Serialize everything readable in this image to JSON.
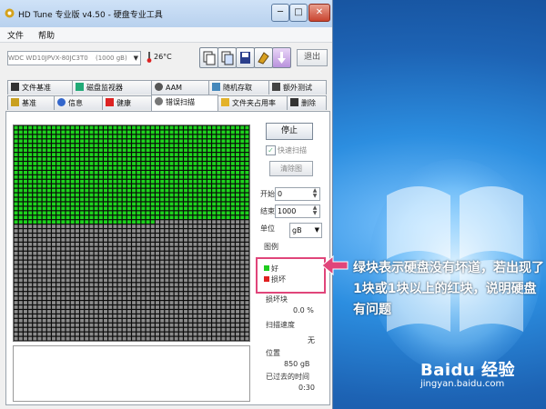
{
  "window": {
    "title": "HD Tune 专业版 v4.50 - 硬盘专业工具",
    "min_glyph": "─",
    "max_glyph": "□",
    "close_glyph": "✕"
  },
  "menu": {
    "items": [
      "文件",
      "帮助"
    ]
  },
  "toolbar": {
    "drive": "WDC WD10JPVX-80JC3T0",
    "drive_size": "(1000 gB)",
    "temperature": "26°C",
    "exit_label": "退出",
    "icons": [
      "copy-text-icon",
      "copy-screenshot-icon",
      "save-icon",
      "options-icon",
      "download-icon"
    ]
  },
  "tabs": {
    "row1": [
      {
        "label": "文件基准",
        "icon": "file-benchmark-icon"
      },
      {
        "label": "磁盘监视器",
        "icon": "disk-monitor-icon"
      },
      {
        "label": "AAM",
        "icon": "aam-icon"
      },
      {
        "label": "随机存取",
        "icon": "random-access-icon"
      },
      {
        "label": "额外测试",
        "icon": "extra-tests-icon"
      }
    ],
    "row2": [
      {
        "label": "基准",
        "icon": "benchmark-icon"
      },
      {
        "label": "信息",
        "icon": "info-icon"
      },
      {
        "label": "健康",
        "icon": "health-icon"
      },
      {
        "label": "错误扫描",
        "icon": "error-scan-icon"
      },
      {
        "label": "文件夹占用率",
        "icon": "folder-usage-icon"
      },
      {
        "label": "删除",
        "icon": "erase-icon"
      }
    ]
  },
  "scan": {
    "start_label": "停止",
    "quick_scan_label": "快速扫描",
    "quick_scan_checked": true,
    "map_button_label": "清除图",
    "start_field_label": "开始",
    "start_value": "0",
    "end_field_label": "结束",
    "end_value": "1000",
    "unit_label": "单位",
    "unit_value": "gB",
    "legend_title": "图例",
    "legend_item_good": "好",
    "legend_item_bad": "损坏",
    "legend_color_good": "#1fcc1f",
    "legend_color_bad": "#e02020",
    "damaged_label": "损坏块",
    "damaged_value": "0.0 %",
    "speed_label": "扫描速度",
    "speed_value": "无",
    "position_label": "位置",
    "position_value": "850 gB",
    "elapsed_label": "已过去的时间",
    "elapsed_value": "0:30",
    "progress_fraction": 0.45,
    "colors": {
      "scanned": "#1ed41e",
      "unscanned": "#8c8c8c",
      "grid": "#0a0a0a"
    }
  },
  "annotation": {
    "text": "绿块表示硬盘没有坏道，若出现了1块或1块以上的红块，说明硬盘有问题",
    "color": "#e0457a"
  },
  "watermark": {
    "brand": "Baidu 经验",
    "url": "jingyan.baidu.com"
  }
}
